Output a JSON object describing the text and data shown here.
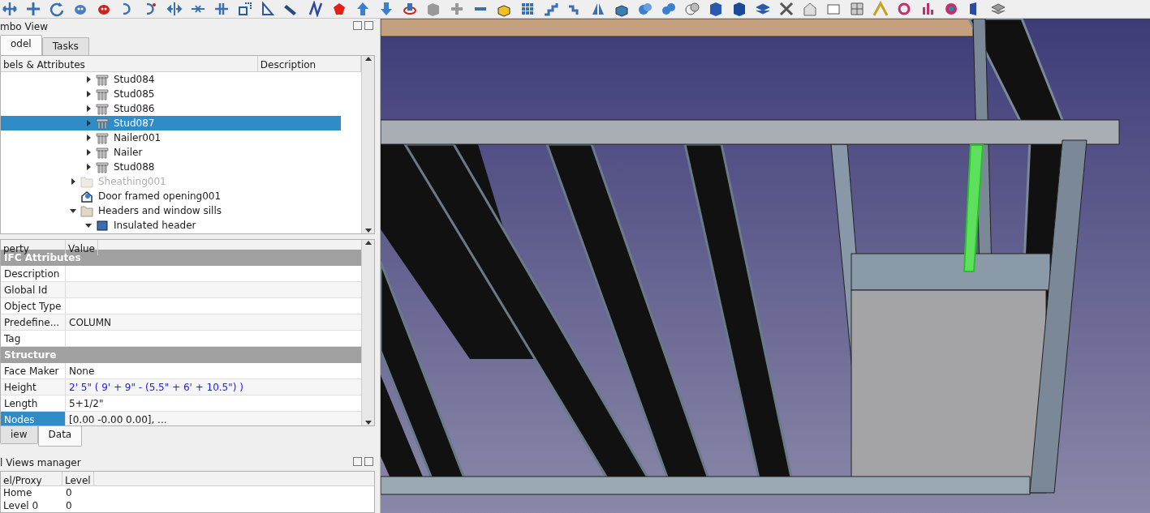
{
  "combo_view": {
    "title": "mbo View",
    "tabs": [
      {
        "label": "odel",
        "selected": true
      },
      {
        "label": "Tasks",
        "selected": false
      }
    ]
  },
  "tree": {
    "columns": [
      "bels & Attributes",
      "Description"
    ],
    "items": [
      {
        "children": [
          {
            "label": "Stud084",
            "kind": "beam",
            "expanded": false,
            "selected": false,
            "hidden": false
          },
          {
            "label": "Stud085",
            "kind": "beam",
            "expanded": false,
            "selected": false,
            "hidden": false
          },
          {
            "label": "Stud086",
            "kind": "beam",
            "expanded": false,
            "selected": false,
            "hidden": false
          },
          {
            "label": "Stud087",
            "kind": "beam",
            "expanded": false,
            "selected": true,
            "hidden": false
          },
          {
            "label": "Nailer001",
            "kind": "beam",
            "expanded": false,
            "selected": false,
            "hidden": false
          },
          {
            "label": "Nailer",
            "kind": "beam",
            "expanded": false,
            "selected": false,
            "hidden": false
          },
          {
            "label": "Stud088",
            "kind": "beam",
            "expanded": false,
            "selected": false,
            "hidden": false
          }
        ]
      },
      {
        "label": "Sheathing001",
        "kind": "folder",
        "expanded": false,
        "selected": false,
        "hidden": true
      },
      {
        "label": "Door framed opening001",
        "kind": "opening",
        "selected": false,
        "hidden": false
      },
      {
        "label": "Headers and window sills",
        "kind": "folder",
        "expanded": true,
        "selected": false,
        "hidden": false,
        "children": [
          {
            "label": "Insulated header",
            "kind": "block",
            "expanded": true,
            "selected": false,
            "hidden": false
          }
        ]
      }
    ]
  },
  "properties": {
    "columns": [
      "perty",
      "Value"
    ],
    "groups": [
      {
        "name": "IFC Attributes",
        "rows": [
          {
            "property": "Description",
            "value": "",
            "selected": false
          },
          {
            "property": "Global Id",
            "value": "",
            "selected": false
          },
          {
            "property": "Object Type",
            "value": "",
            "selected": false
          },
          {
            "property": "Predefine...",
            "value": "COLUMN",
            "selected": false,
            "expression": false
          },
          {
            "property": "Tag",
            "value": "",
            "selected": false
          }
        ]
      },
      {
        "name": "Structure",
        "rows": [
          {
            "property": "Face Maker",
            "value": "None",
            "selected": false,
            "expression": false
          },
          {
            "property": "Height",
            "value": "2' 5\"  ( 9' + 9\" - (5.5\" + 6' + 10.5\") )",
            "selected": false,
            "expression": true
          },
          {
            "property": "Length",
            "value": "5+1/2\"",
            "selected": false,
            "expression": false
          },
          {
            "property": "Nodes",
            "value": "[0.00 -0.00 0.00], ...",
            "selected": true,
            "expression": false
          }
        ]
      }
    ],
    "tabs": [
      {
        "label": "iew",
        "selected": false
      },
      {
        "label": "Data",
        "selected": true
      }
    ]
  },
  "views_manager": {
    "title": "l Views manager",
    "columns": [
      "el/Proxy",
      "Level"
    ],
    "rows": [
      {
        "name": "Home",
        "level": "0"
      },
      {
        "name": "Level 0",
        "level": "0"
      }
    ]
  }
}
